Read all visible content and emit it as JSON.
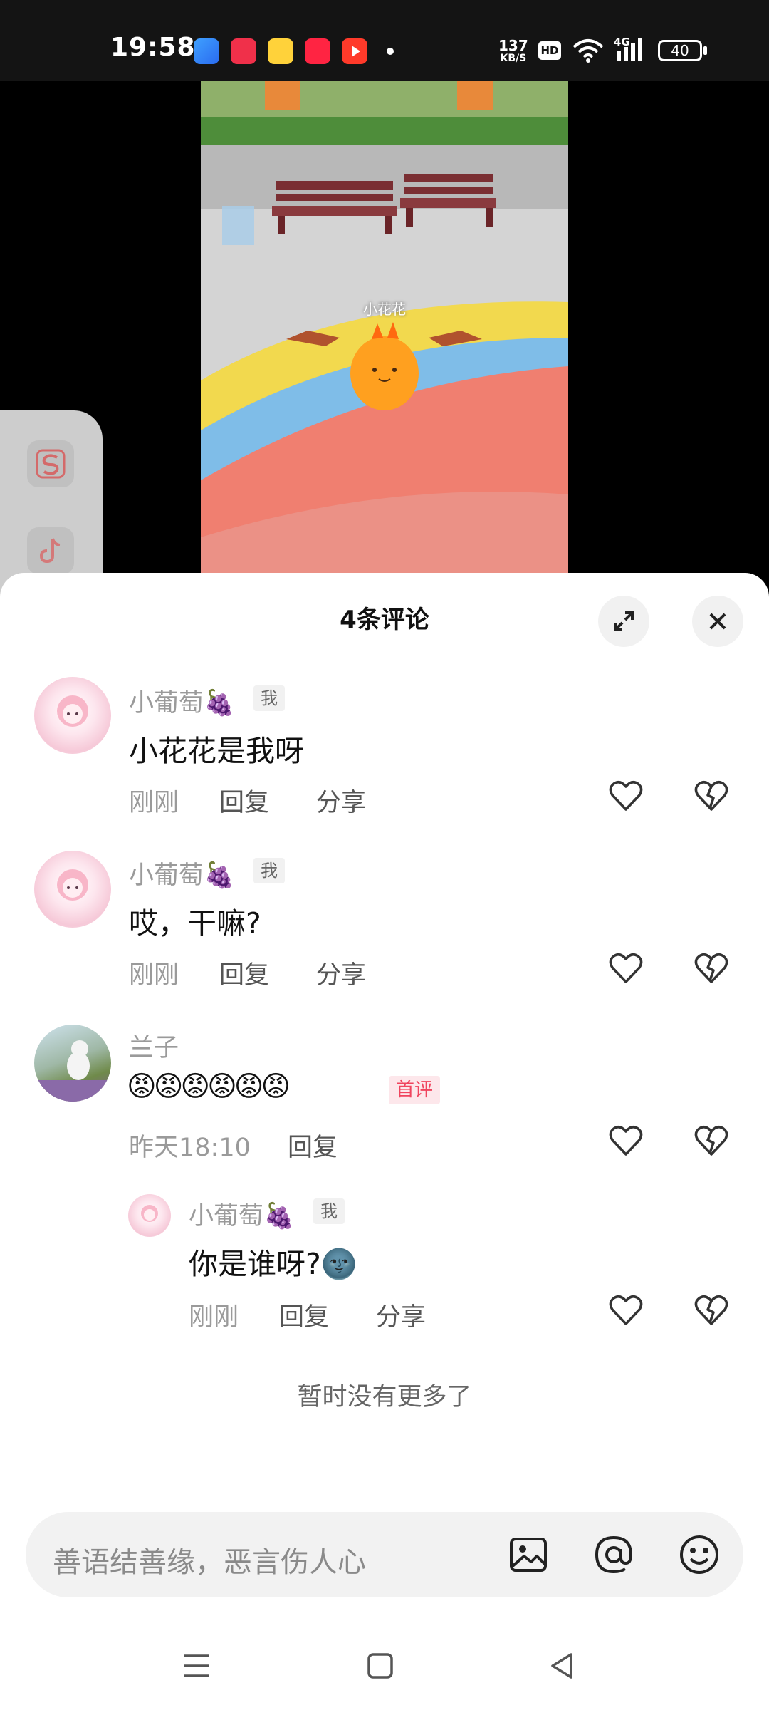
{
  "status_bar": {
    "time": "19:58",
    "network_speed_value": "137",
    "network_speed_unit": "KB/S",
    "hd_label": "HD",
    "signal_label": "4G",
    "battery": "40"
  },
  "video": {
    "character_name": "小花花"
  },
  "comments_panel": {
    "title": "4条评论",
    "comments": [
      {
        "user": "小葡萄🍇",
        "tag": "我",
        "text": "小花花是我呀",
        "time": "刚刚",
        "reply_label": "回复",
        "share_label": "分享"
      },
      {
        "user": "小葡萄🍇",
        "tag": "我",
        "text": "哎，干嘛?",
        "time": "刚刚",
        "reply_label": "回复",
        "share_label": "分享"
      },
      {
        "user": "兰子",
        "text": "😡😡😡😡😡😡",
        "first_tag": "首评",
        "time": "昨天18:10",
        "reply_label": "回复"
      },
      {
        "user": "小葡萄🍇",
        "tag": "我",
        "text": "你是谁呀?🌚",
        "time": "刚刚",
        "reply_label": "回复",
        "share_label": "分享"
      }
    ],
    "no_more": "暂时没有更多了",
    "input_placeholder": "善语结善缘，恶言伤人心"
  },
  "colors": {
    "accent_tag": "#f0445e",
    "sheet_bg": "#ffffff",
    "status_bg": "#141414"
  }
}
